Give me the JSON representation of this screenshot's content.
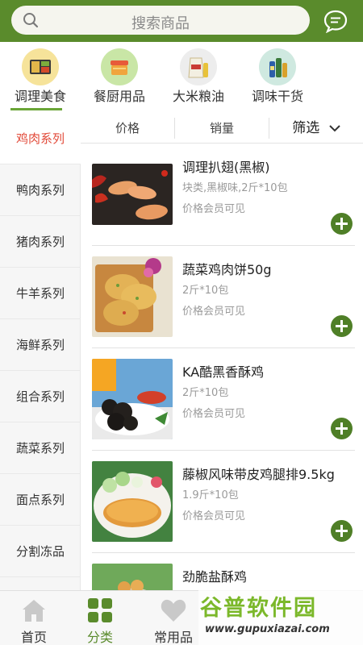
{
  "header": {
    "search_placeholder": "搜索商品",
    "icons": {
      "search": "search-icon",
      "message": "chat-bubble-icon"
    }
  },
  "categories": [
    {
      "label": "调理美食",
      "icon": "bento-box-icon",
      "active": true
    },
    {
      "label": "餐厨用品",
      "icon": "food-container-icon",
      "active": false
    },
    {
      "label": "大米粮油",
      "icon": "rice-bag-icon",
      "active": false
    },
    {
      "label": "调味干货",
      "icon": "seasoning-bottles-icon",
      "active": false
    }
  ],
  "sidebar": {
    "items": [
      {
        "label": "鸡肉系列",
        "active": true
      },
      {
        "label": "鸭肉系列",
        "active": false
      },
      {
        "label": "猪肉系列",
        "active": false
      },
      {
        "label": "牛羊系列",
        "active": false
      },
      {
        "label": "海鲜系列",
        "active": false
      },
      {
        "label": "组合系列",
        "active": false
      },
      {
        "label": "蔬菜系列",
        "active": false
      },
      {
        "label": "面点系列",
        "active": false
      },
      {
        "label": "分割冻品",
        "active": false
      }
    ]
  },
  "filter": {
    "price": "价格",
    "sales": "销量",
    "filter": "筛选"
  },
  "products": [
    {
      "name": "调理扒翅(黑椒)",
      "spec": "块类,黑椒味,2斤*10包",
      "price_note": "价格会员可见",
      "image": "grilled-wings-photo"
    },
    {
      "name": "蔬菜鸡肉饼50g",
      "spec": "2斤*10包",
      "price_note": "价格会员可见",
      "image": "chicken-patties-photo"
    },
    {
      "name": "KA酷黑香酥鸡",
      "spec": "2斤*10包",
      "price_note": "价格会员可见",
      "image": "black-crispy-chicken-photo"
    },
    {
      "name": "藤椒风味带皮鸡腿排9.5kg",
      "spec": "1.9斤*10包",
      "price_note": "价格会员可见",
      "image": "chicken-cutlet-photo"
    },
    {
      "name": "劲脆盐酥鸡",
      "spec": "",
      "price_note": "",
      "image": "popcorn-chicken-photo"
    }
  ],
  "tabbar": [
    {
      "label": "首页",
      "icon": "home-icon",
      "active": false
    },
    {
      "label": "分类",
      "icon": "category-grid-icon",
      "active": true
    },
    {
      "label": "常用品",
      "icon": "heart-icon",
      "active": false
    }
  ],
  "watermark": {
    "title": "谷普软件园",
    "url": "www.gupuxiazai.com"
  },
  "colors": {
    "brand_green": "#5a8b2c",
    "active_red": "#e24a39",
    "add_button": "#4f7f27"
  }
}
